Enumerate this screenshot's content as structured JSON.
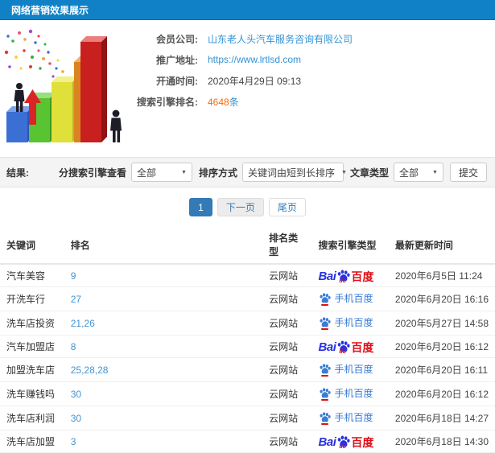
{
  "titlebar": {
    "title": "网络营销效果展示"
  },
  "info": {
    "fields": [
      {
        "label": "会员公司:",
        "value": "山东老人头汽车服务咨询有限公司"
      },
      {
        "label": "推广地址:",
        "value": "https://www.lrtlsd.com"
      },
      {
        "label": "开通时间:",
        "value": "2020年4月29日 09:13"
      },
      {
        "label": "搜索引擎排名:",
        "value": "4648",
        "suffix": "条"
      }
    ]
  },
  "filters": {
    "result_label": "结果:",
    "engine_label": "分搜索引擎查看",
    "engine_value": "全部",
    "sort_label": "排序方式",
    "sort_value": "关键词由短到长排序",
    "article_label": "文章类型",
    "article_value": "全部",
    "submit_label": "提交"
  },
  "pagination": {
    "current": "1",
    "next": "下一页",
    "last": "尾页"
  },
  "table": {
    "headers": [
      "关键词",
      "排名",
      "排名类型",
      "搜索引擎类型",
      "最新更新时间"
    ],
    "rows": [
      {
        "keyword": "汽车美容",
        "rank": "9",
        "rank_type": "云网站",
        "engine": "baidu-pc",
        "time": "2020年6月5日 11:24"
      },
      {
        "keyword": "开洗车行",
        "rank": "27",
        "rank_type": "云网站",
        "engine": "baidu-mobile",
        "time": "2020年6月20日 16:16"
      },
      {
        "keyword": "洗车店投资",
        "rank": "21,26",
        "rank_type": "云网站",
        "engine": "baidu-mobile",
        "time": "2020年5月27日 14:58"
      },
      {
        "keyword": "汽车加盟店",
        "rank": "8",
        "rank_type": "云网站",
        "engine": "baidu-pc",
        "time": "2020年6月20日 16:12"
      },
      {
        "keyword": "加盟洗车店",
        "rank": "25,28,28",
        "rank_type": "云网站",
        "engine": "baidu-mobile",
        "time": "2020年6月20日 16:11"
      },
      {
        "keyword": "洗车赚钱吗",
        "rank": "30",
        "rank_type": "云网站",
        "engine": "baidu-mobile",
        "time": "2020年6月20日 16:12"
      },
      {
        "keyword": "洗车店利润",
        "rank": "30",
        "rank_type": "云网站",
        "engine": "baidu-mobile",
        "time": "2020年6月18日 14:27"
      },
      {
        "keyword": "洗车店加盟",
        "rank": "3",
        "rank_type": "云网站",
        "engine": "baidu-pc",
        "time": "2020年6月18日 14:30"
      }
    ]
  },
  "engine_labels": {
    "baidu_pc_prefix": "Bai",
    "baidu_pc_du": "du",
    "baidu_pc_suffix": "百度",
    "baidu_mobile": "手机百度"
  },
  "colors": {
    "titlebar_blue": "#1081c6",
    "link_blue": "#3293d6",
    "rank_orange": "#ff6600",
    "baidu_blue": "#2932e1",
    "baidu_red": "#de0f17",
    "active_page_blue": "#337ab7"
  }
}
